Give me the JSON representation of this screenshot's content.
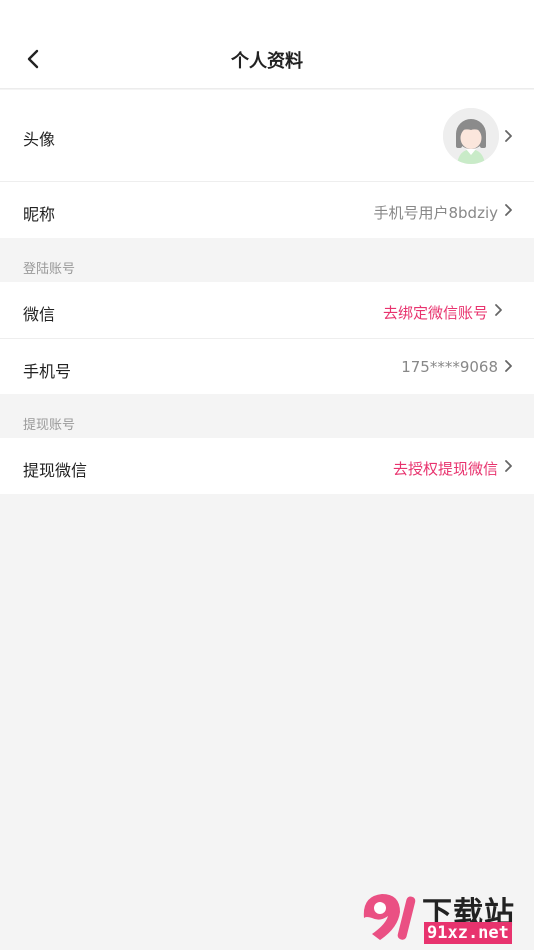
{
  "header": {
    "title": "个人资料",
    "back_icon": "chevron-left-icon"
  },
  "profile": {
    "avatar_label": "头像",
    "nickname_label": "昵称",
    "nickname_value": "手机号用户8bdziy"
  },
  "login_section": {
    "title": "登陆账号",
    "wechat_label": "微信",
    "wechat_value": "去绑定微信账号",
    "phone_label": "手机号",
    "phone_value": "175****9068"
  },
  "withdraw_section": {
    "title": "提现账号",
    "wechat_label": "提现微信",
    "wechat_value": "去授权提现微信"
  },
  "watermark": {
    "text": "下载站",
    "url": "91xz.net",
    "mark": "91"
  },
  "colors": {
    "accent": "#e8336e",
    "background": "#f4f4f4",
    "secondary_text": "#888888"
  }
}
